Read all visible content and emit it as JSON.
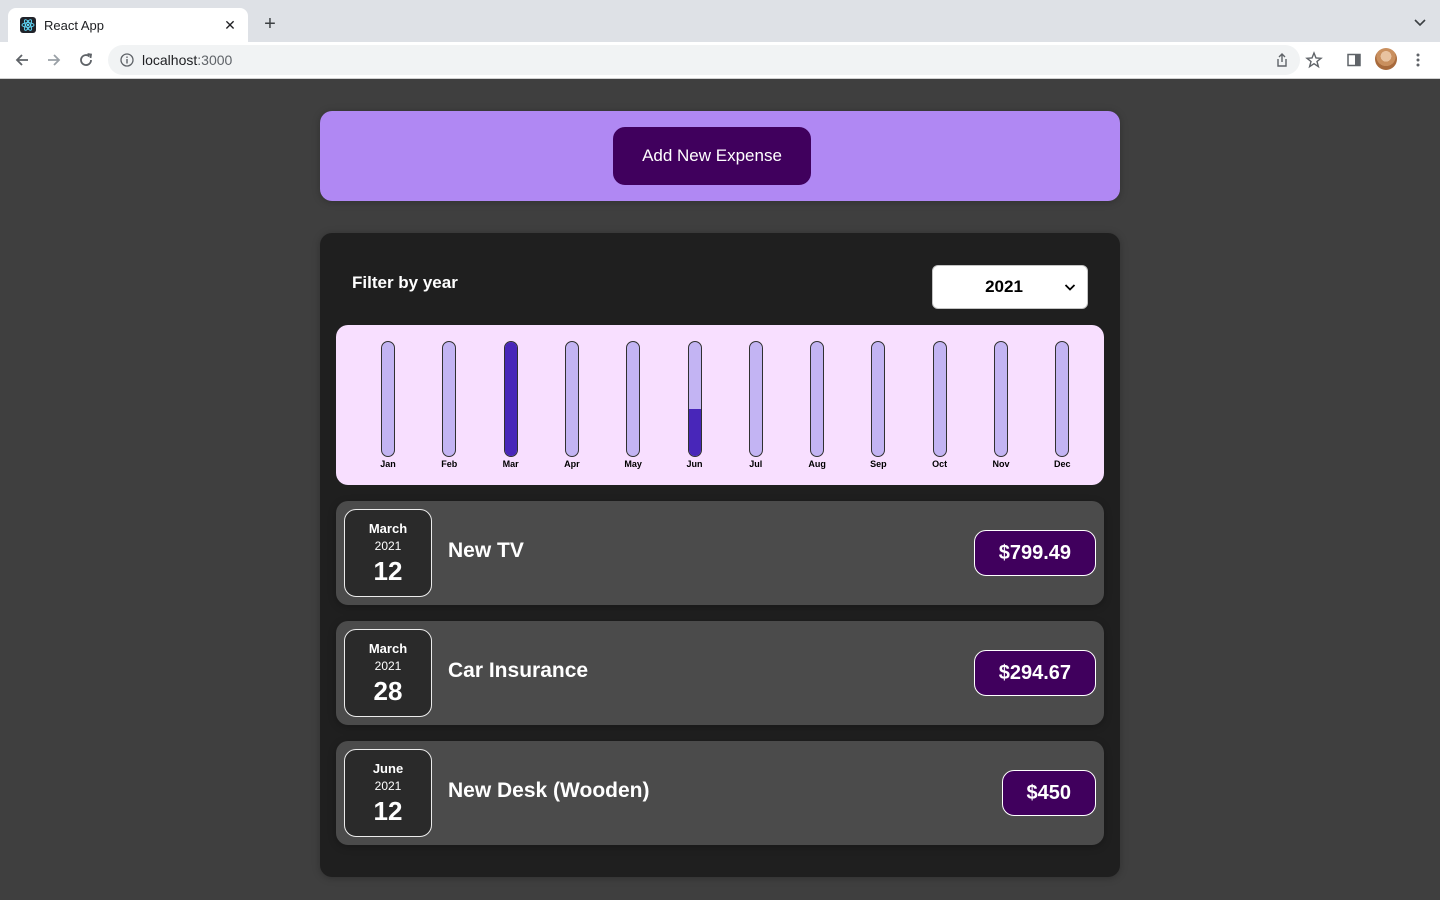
{
  "browser": {
    "tab_title": "React App",
    "url_host": "localhost",
    "url_port": ":3000",
    "icons": {
      "favicon": "react-icon",
      "tab_close": "close-icon",
      "new_tab": "plus-icon",
      "tab_search": "chevron-down-icon",
      "back": "arrow-left-icon",
      "forward": "arrow-right-icon",
      "reload": "reload-icon",
      "site_info": "info-icon",
      "share": "share-icon",
      "bookmark": "star-icon",
      "side_panel": "side-panel-icon",
      "menu": "kebab-menu-icon"
    }
  },
  "new_expense": {
    "button_label": "Add New Expense"
  },
  "filter": {
    "label": "Filter by year",
    "selected_year": "2021"
  },
  "chart_data": {
    "type": "bar",
    "categories": [
      "Jan",
      "Feb",
      "Mar",
      "Apr",
      "May",
      "Jun",
      "Jul",
      "Aug",
      "Sep",
      "Oct",
      "Nov",
      "Dec"
    ],
    "values": [
      0,
      0,
      1094.16,
      0,
      0,
      450,
      0,
      0,
      0,
      0,
      0,
      0
    ],
    "fill_fraction": [
      0,
      0,
      1,
      0,
      0,
      0.41,
      0,
      0,
      0,
      0,
      0,
      0
    ],
    "title": "",
    "xlabel": "",
    "ylabel": "",
    "grid": false
  },
  "expenses": [
    {
      "month": "March",
      "year": "2021",
      "day": "12",
      "title": "New TV",
      "amount": "$799.49"
    },
    {
      "month": "March",
      "year": "2021",
      "day": "28",
      "title": "Car Insurance",
      "amount": "$294.67"
    },
    {
      "month": "June",
      "year": "2021",
      "day": "12",
      "title": "New Desk (Wooden)",
      "amount": "$450"
    }
  ],
  "colors": {
    "page_bg": "#3f3f3f",
    "new_expense_bg": "#b088f3",
    "button_bg": "#40005d",
    "card_bg": "#1f1f1f",
    "chart_bg": "#f8dfff",
    "bar_empty": "#c3b4f3",
    "bar_fill": "#4826b9",
    "item_bg": "#4b4b4b"
  }
}
